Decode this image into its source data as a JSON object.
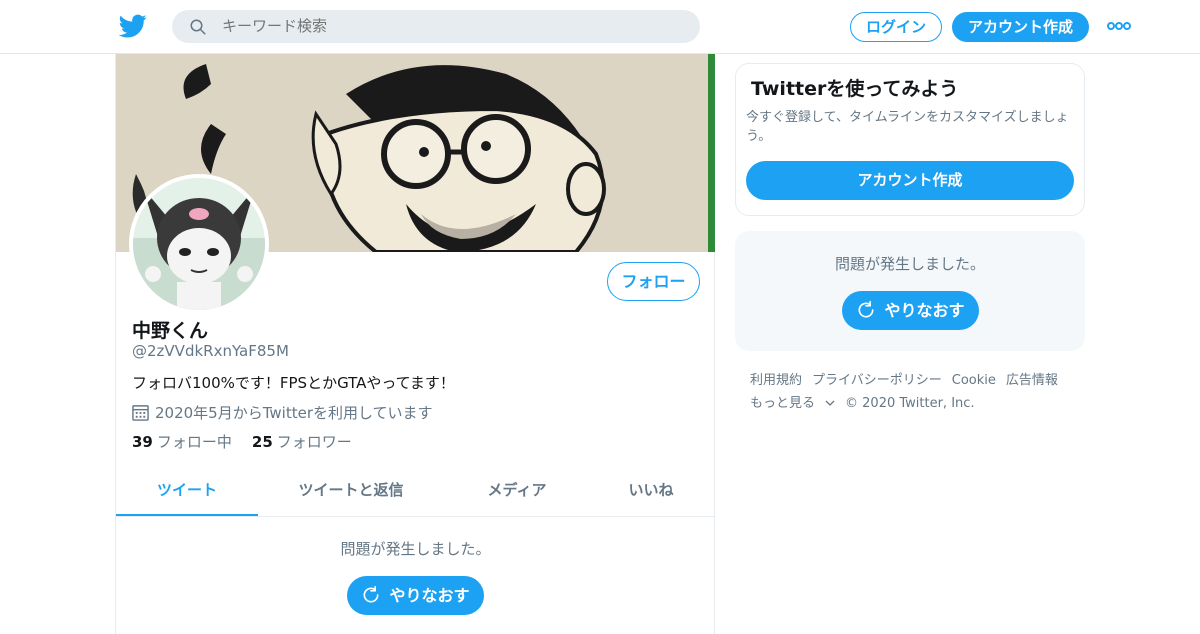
{
  "header": {
    "search_placeholder": "キーワード検索",
    "login_label": "ログイン",
    "signup_label": "アカウント作成",
    "logo_icon": "twitter-bird-icon",
    "more_icon": "more-dots-icon"
  },
  "profile": {
    "follow_label": "フォロー",
    "name": "中野くん",
    "handle": "@2zVVdkRxnYaF85M",
    "bio": "フォロバ100%です！FPSとかGTAやってます！",
    "joined": "2020年5月からTwitterを利用しています",
    "following_count": "39",
    "following_label": "フォロー中",
    "followers_count": "25",
    "followers_label": "フォロワー"
  },
  "tabs": [
    {
      "label": "ツイート",
      "active": true
    },
    {
      "label": "ツイートと返信",
      "active": false
    },
    {
      "label": "メディア",
      "active": false
    },
    {
      "label": "いいね",
      "active": false
    }
  ],
  "main_error": {
    "message": "問題が発生しました。",
    "retry_label": "やりなおす"
  },
  "sidebar": {
    "title": "Twitterを使ってみよう",
    "description": "今すぐ登録して、タイムラインをカスタマイズしましょう。",
    "signup_label": "アカウント作成",
    "error_message": "問題が発生しました。",
    "retry_label": "やりなおす"
  },
  "footer": {
    "links": [
      "利用規約",
      "プライバシーポリシー",
      "Cookie",
      "広告情報"
    ],
    "more_label": "もっと見る",
    "copyright": "© 2020 Twitter, Inc."
  },
  "colors": {
    "accent": "#1da1f2",
    "text_primary": "#14171a",
    "text_secondary": "#657786"
  }
}
